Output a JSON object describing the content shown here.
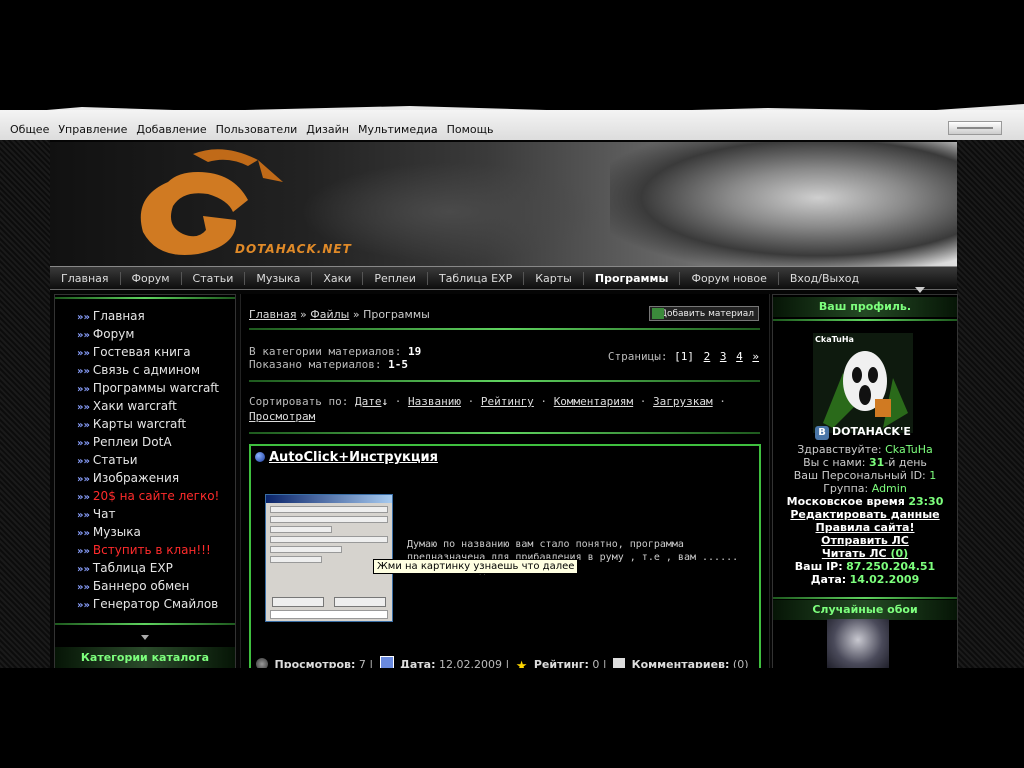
{
  "topmenu": [
    "Общее",
    "Управление",
    "Добавление",
    "Пользователи",
    "Дизайн",
    "Мультимедиа",
    "Помощь"
  ],
  "logo": {
    "text": "DOTAHACK.NET"
  },
  "navbar": [
    "Главная",
    "Форум",
    "Статьи",
    "Музыка",
    "Хаки",
    "Реплеи",
    "Таблица EXP",
    "Карты",
    "Программы",
    "Форум новое",
    "Вход/Выход"
  ],
  "left_menu": [
    {
      "label": "Главная",
      "red": false
    },
    {
      "label": "Форум",
      "red": false
    },
    {
      "label": "Гостевая книга",
      "red": false
    },
    {
      "label": "Связь с админом",
      "red": false
    },
    {
      "label": "Программы warcraft",
      "red": false
    },
    {
      "label": "Хаки warcraft",
      "red": false
    },
    {
      "label": "Карты warcraft",
      "red": false
    },
    {
      "label": "Реплеи DotA",
      "red": false
    },
    {
      "label": "Статьи",
      "red": false
    },
    {
      "label": "Изображения",
      "red": false
    },
    {
      "label": "20$ на сайте легко!",
      "red": true
    },
    {
      "label": "Чат",
      "red": false
    },
    {
      "label": "Музыка",
      "red": false
    },
    {
      "label": "Вступить в клан!!!",
      "red": true
    },
    {
      "label": "Таблица EXP",
      "red": false
    },
    {
      "label": "Баннеро обмен",
      "red": false
    },
    {
      "label": "Генератор Смайлов",
      "red": false
    }
  ],
  "catalog_header": "Категории каталога",
  "breadcrumb": {
    "home": "Главная",
    "files": "Файлы",
    "current": "Программы",
    "sep": "»"
  },
  "add_material": "Добавить материал",
  "stats": {
    "in_category_label": "В категории материалов:",
    "in_category": "19",
    "shown_label": "Показано материалов:",
    "shown": "1-5"
  },
  "pages": {
    "label": "Страницы:",
    "current": "[1]",
    "list": [
      "2",
      "3",
      "4",
      "»"
    ]
  },
  "sort": {
    "label": "Сортировать по:",
    "options": [
      "Дате",
      "Названию",
      "Рейтингу",
      "Комментариям",
      "Загрузкам",
      "Просмотрам"
    ]
  },
  "entry": {
    "title": "AutoClick+Инструкция",
    "description": "Думаю по названию вам стало понятно, программа предназначена для прибавления в руму , т.е , вам ...... а сама всё сделает за вас",
    "tooltip": "Жми на картинку узнаешь что далее",
    "views_label": "Просмотров:",
    "views": "7",
    "date_label": "Дата:",
    "date": "12.02.2009",
    "rating_label": "Рейтинг:",
    "rating": "0",
    "comments_label": "Комментариев:",
    "comments": "(0)",
    "thumb_title": "AutoClick 2.7"
  },
  "profile": {
    "header": "Ваш профиль.",
    "avatar_caption": "CkaTuHa",
    "vk_label": "DOTAHACK'E",
    "greet_label": "Здравствуйте:",
    "username": "CkaTuHa",
    "with_us_label": "Вы с нами:",
    "days": "31",
    "days_suffix": "-й день",
    "id_label": "Ваш Персональный ID:",
    "id": "1",
    "group_label": "Группа:",
    "group": "Admin",
    "moscow_label": "Московское время",
    "moscow_time": "23:30",
    "edit_link": "Редактировать данные",
    "rules_link": "Правила сайта!",
    "send_pm": "Отправить ЛС",
    "read_pm": "Читать ЛС",
    "pm_count": "(0)",
    "ip_label": "Ваш IP:",
    "ip": "87.250.204.51",
    "date_label": "Дата:",
    "date": "14.02.2009"
  },
  "random_wallpaper_header": "Случайные обои",
  "colors": {
    "accent_green": "#5fd35f",
    "red_link": "#ff2b2b",
    "logo_orange": "#e08a28"
  }
}
